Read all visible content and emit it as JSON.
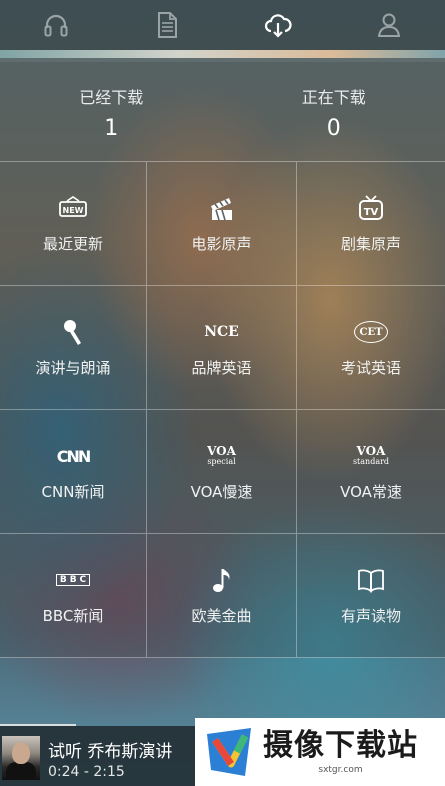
{
  "tabs": [
    {
      "icon": "headphones-icon"
    },
    {
      "icon": "document-icon"
    },
    {
      "icon": "cloud-download-icon",
      "active": true
    },
    {
      "icon": "user-icon"
    }
  ],
  "counts": {
    "downloaded_label": "已经下载",
    "downloaded_value": "1",
    "downloading_label": "正在下载",
    "downloading_value": "0"
  },
  "categories": [
    {
      "label": "最近更新",
      "icon": "new-badge-icon"
    },
    {
      "label": "电影原声",
      "icon": "clapperboard-icon"
    },
    {
      "label": "剧集原声",
      "icon": "tv-icon"
    },
    {
      "label": "演讲与朗诵",
      "icon": "microphone-icon"
    },
    {
      "label": "品牌英语",
      "icon_text": "NCE"
    },
    {
      "label": "考试英语",
      "icon_text": "CET"
    },
    {
      "label": "CNN新闻",
      "icon_text": "CNN"
    },
    {
      "label": "VOA慢速",
      "icon_text": "VOA",
      "icon_sub": "special"
    },
    {
      "label": "VOA常速",
      "icon_text": "VOA",
      "icon_sub": "standard"
    },
    {
      "label": "BBC新闻",
      "icon_text": "BBC"
    },
    {
      "label": "欧美金曲",
      "icon": "music-note-icon"
    },
    {
      "label": "有声读物",
      "icon": "book-icon"
    }
  ],
  "player": {
    "title": "试听 乔布斯演讲",
    "time": "0:24 - 2:15",
    "progress": 0.17
  },
  "watermark": {
    "title": "摄像下载站",
    "url": "sxtgr.com"
  }
}
